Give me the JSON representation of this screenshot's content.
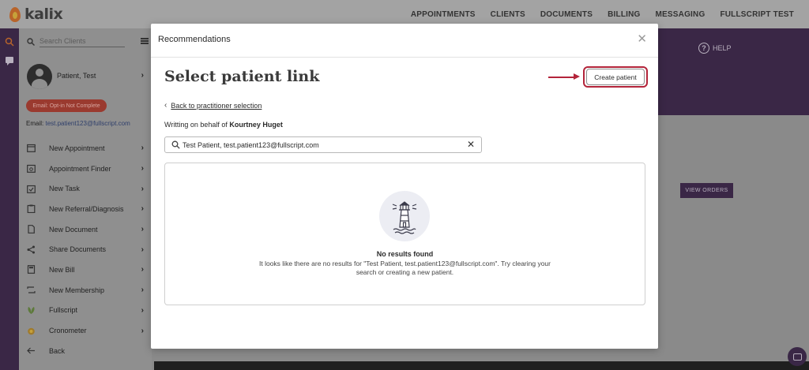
{
  "app": {
    "logo_text": "kalix",
    "nav": [
      "APPOINTMENTS",
      "CLIENTS",
      "DOCUMENTS",
      "BILLING",
      "MESSAGING",
      "FULLSCRIPT TEST"
    ],
    "help_label": "HELP",
    "view_orders_label": "VIEW ORDERS"
  },
  "sidebar": {
    "search_placeholder": "Search Clients",
    "patient_name": "Patient, Test",
    "optin_badge": "Email: Opt-in Not Complete",
    "email_label": "Email:",
    "email_value": "test.patient123@fullscript.com",
    "items": [
      {
        "label": "New Appointment",
        "icon": "calendar-icon"
      },
      {
        "label": "Appointment Finder",
        "icon": "calendar-search-icon"
      },
      {
        "label": "New Task",
        "icon": "task-check-icon"
      },
      {
        "label": "New Referral/Diagnosis",
        "icon": "clipboard-icon"
      },
      {
        "label": "New Document",
        "icon": "document-icon"
      },
      {
        "label": "Share Documents",
        "icon": "share-icon"
      },
      {
        "label": "New Bill",
        "icon": "calculator-icon"
      },
      {
        "label": "New Membership",
        "icon": "repeat-icon"
      },
      {
        "label": "Fullscript",
        "icon": "fullscript-leaf-icon"
      },
      {
        "label": "Cronometer",
        "icon": "cronometer-icon"
      },
      {
        "label": "Back",
        "icon": "back-arrow-icon"
      }
    ]
  },
  "modal": {
    "title": "Recommendations",
    "heading": "Select patient link",
    "create_patient_label": "Create patient",
    "back_link_label": "Back to practitioner selection",
    "behalf_prefix": "Writting on behalf of",
    "behalf_name": "Kourtney Huget",
    "search_value": "Test Patient, test.patient123@fullscript.com",
    "no_results_title": "No results found",
    "no_results_desc": "It looks like there are no results for \"Test Patient, test.patient123@fullscript.com\". Try clearing your search or creating a new patient."
  },
  "colors": {
    "brand_purple": "#3a2746",
    "highlight_red": "#b3243a"
  }
}
